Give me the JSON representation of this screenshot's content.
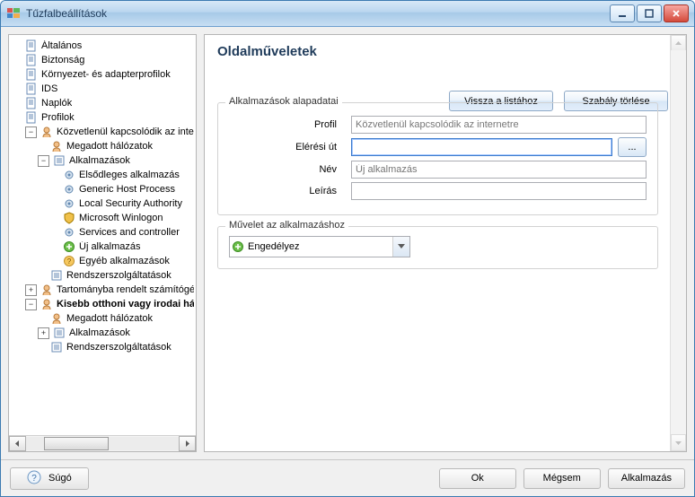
{
  "window": {
    "title": "Tűzfalbeállítások"
  },
  "tree": {
    "items": {
      "general": {
        "label": "Általános"
      },
      "security": {
        "label": "Biztonság"
      },
      "envadapter": {
        "label": "Környezet- és adapterprofilok"
      },
      "ids": {
        "label": "IDS"
      },
      "logs": {
        "label": "Naplók"
      },
      "profiles": {
        "label": "Profilok"
      },
      "p_direct": {
        "label": "Közvetlenül kapcsolódik az internetre"
      },
      "p_d_nets": {
        "label": "Megadott hálózatok"
      },
      "p_d_apps": {
        "label": "Alkalmazások"
      },
      "app_primary": {
        "label": "Elsődleges alkalmazás"
      },
      "app_ghp": {
        "label": "Generic Host Process"
      },
      "app_lsa": {
        "label": "Local Security Authority"
      },
      "app_winlog": {
        "label": "Microsoft Winlogon"
      },
      "app_svc": {
        "label": "Services and controller"
      },
      "app_new": {
        "label": "Új alkalmazás"
      },
      "app_other": {
        "label": "Egyéb alkalmazások"
      },
      "p_d_sys": {
        "label": "Rendszerszolgáltatások"
      },
      "p_domain": {
        "label": "Tartományba rendelt számítógép"
      },
      "p_soho": {
        "label": "Kisebb otthoni vagy irodai hálózat"
      },
      "p_s_nets": {
        "label": "Megadott hálózatok"
      },
      "p_s_apps": {
        "label": "Alkalmazások"
      },
      "p_s_sys": {
        "label": "Rendszerszolgáltatások"
      }
    }
  },
  "detail": {
    "heading": "Oldalműveletek",
    "btn_back": "Vissza a listához",
    "btn_delete": "Szabály törlése",
    "group_basic": {
      "legend": "Alkalmazások alapadatai",
      "profile_label": "Profil",
      "profile_value": "Közvetlenül kapcsolódik az internetre",
      "path_label": "Elérési út",
      "path_value": "",
      "browse_label": "...",
      "name_label": "Név",
      "name_placeholder": "Új alkalmazás",
      "desc_label": "Leírás",
      "desc_value": ""
    },
    "group_action": {
      "legend": "Művelet az alkalmazáshoz",
      "selected": "Engedélyez"
    }
  },
  "footer": {
    "help": "Súgó",
    "ok": "Ok",
    "cancel": "Mégsem",
    "apply": "Alkalmazás"
  },
  "icons": {
    "app": "firewall-icon"
  }
}
